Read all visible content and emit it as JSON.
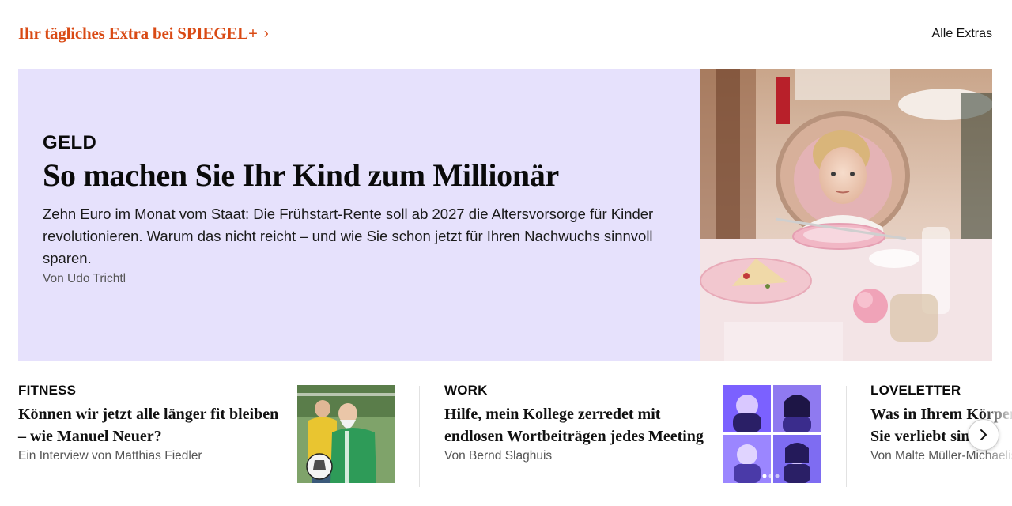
{
  "header": {
    "title": "Ihr tägliches Extra bei SPIEGEL+",
    "chevron": "›",
    "all_link": "Alle Extras"
  },
  "hero": {
    "kicker": "GELD",
    "headline": "So machen Sie Ihr Kind zum Millionär",
    "teaser": "Zehn Euro im Monat vom Staat: Die Frühstart-Rente soll ab 2027 die Altersvorsorge für Kinder revolutionieren. Warum das nicht reicht – und wie Sie schon jetzt für Ihren Nachwuchs sinnvoll sparen.",
    "author": "Von Udo Trichtl",
    "background_color": "#e6e1fc"
  },
  "cards": [
    {
      "kicker": "FITNESS",
      "headline": "Können wir jetzt alle länger fit bleiben – wie Manuel Neuer?",
      "author": "Ein Interview von Matthias Fiedler"
    },
    {
      "kicker": "WORK",
      "headline": "Hilfe, mein Kollege zerredet mit endlosen Wortbeiträgen jedes Meeting",
      "author": "Von Bernd Slaghuis"
    },
    {
      "kicker": "LOVELETTER",
      "headline": "Was in Ihrem Körper passiert, wenn Sie verliebt sind",
      "author": "Von Malte Müller-Michaelis"
    }
  ],
  "carousel": {
    "next_icon": "chevron-right-icon"
  },
  "colors": {
    "accent": "#d94a14",
    "hero_bg": "#e6e1fc"
  }
}
